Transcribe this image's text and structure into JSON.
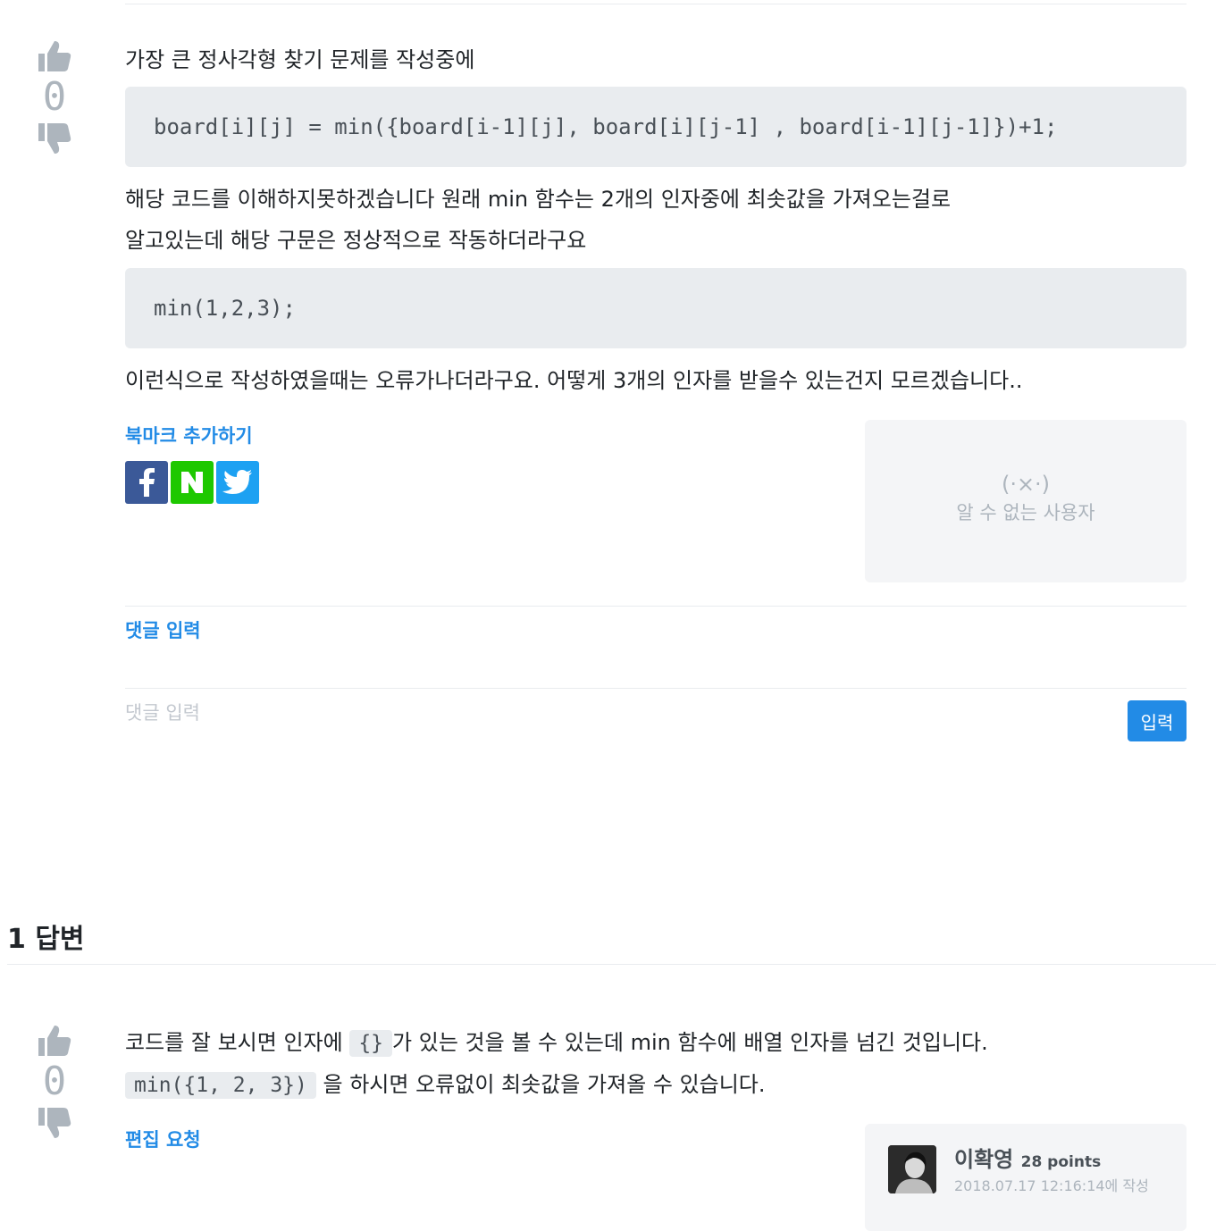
{
  "question": {
    "votes": "0",
    "line1": "가장 큰 정사각형 찾기 문제를 작성중에",
    "code1": "board[i][j] = min({board[i-1][j], board[i][j-1] , board[i-1][j-1]})+1;",
    "line2": "해당 코드를 이해하지못하겠습니다 원래 min 함수는 2개의 인자중에 최솟값을 가져오는걸로",
    "line3": "알고있는데 해당 구문은 정상적으로 작동하더라구요",
    "code2": "min(1,2,3);",
    "line4": "이런식으로 작성하였을때는 오류가나더라구요. 어떻게 3개의 인자를 받을수 있는건지 모르겠습니다..",
    "bookmark_label": "북마크 추가하기",
    "user_face": "(·×·)",
    "user_name": "알 수 없는 사용자"
  },
  "comments": {
    "title": "댓글 입력",
    "placeholder": "댓글 입력",
    "submit_label": "입력"
  },
  "answers": {
    "title": "1 답변",
    "items": [
      {
        "votes": "0",
        "text1_a": "코드를 잘 보시면 인자에",
        "text1_code": "{}",
        "text1_b": "가 있는 것을 볼 수 있는데 min 함수에 배열 인자를 넘긴 것입니다.",
        "text2_code": "min({1, 2, 3})",
        "text2_b": "을 하시면 오류없이 최솟값을 가져올 수 있습니다.",
        "edit_label": "편집 요청",
        "author_name": "이확영",
        "author_points": "28 points",
        "author_meta": "2018.07.17 12:16:14에 작성"
      }
    ]
  }
}
